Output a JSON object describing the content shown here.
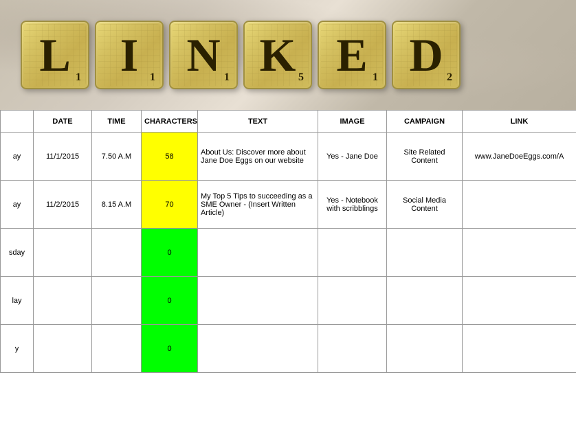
{
  "header": {
    "tiles": [
      {
        "letter": "L",
        "score": "1"
      },
      {
        "letter": "I",
        "score": "1"
      },
      {
        "letter": "N",
        "score": "1"
      },
      {
        "letter": "K",
        "score": "5"
      },
      {
        "letter": "E",
        "score": "1"
      },
      {
        "letter": "D",
        "score": "2"
      }
    ]
  },
  "table": {
    "headers": [
      "",
      "DATE",
      "TIME",
      "CHARACTERS",
      "TEXT",
      "IMAGE",
      "CAMPAIGN",
      "LINK"
    ],
    "rows": [
      {
        "day": "ay",
        "date": "11/1/2015",
        "time": "7.50 A.M",
        "characters": "58",
        "characters_color": "yellow",
        "text": "About Us: Discover more about Jane Doe Eggs on our website",
        "image": "Yes - Jane Doe",
        "campaign": "Site Related Content",
        "link": "www.JaneDoeEggs.com/A"
      },
      {
        "day": "ay",
        "date": "11/2/2015",
        "time": "8.15 A.M",
        "characters": "70",
        "characters_color": "yellow",
        "text": "My Top 5 Tips to succeeding as a SME Owner - (Insert Written Article)",
        "image": "Yes - Notebook with scribblings",
        "campaign": "Social Media Content",
        "link": ""
      },
      {
        "day": "sday",
        "date": "",
        "time": "",
        "characters": "0",
        "characters_color": "green",
        "text": "",
        "image": "",
        "campaign": "",
        "link": ""
      },
      {
        "day": "lay",
        "date": "",
        "time": "",
        "characters": "0",
        "characters_color": "green",
        "text": "",
        "image": "",
        "campaign": "",
        "link": ""
      },
      {
        "day": "y",
        "date": "",
        "time": "",
        "characters": "0",
        "characters_color": "green",
        "text": "",
        "image": "",
        "campaign": "",
        "link": ""
      }
    ]
  }
}
